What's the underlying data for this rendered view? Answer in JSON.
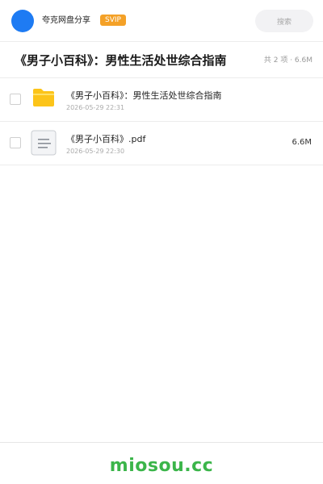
{
  "header": {
    "app_name": "夸克网盘分享",
    "badge": "SVIP",
    "search_placeholder": "搜索"
  },
  "folder": {
    "title": "《男子小百科》：男性生活处世综合指南",
    "summary": "共 2 项 · 6.6M"
  },
  "files": [
    {
      "type": "folder",
      "icon": "folder-icon",
      "name": "《男子小百科》：男性生活处世综合指南",
      "date": "2026-05-29 22:31",
      "size": ""
    },
    {
      "type": "document",
      "icon": "document-icon",
      "name": "《男子小百科》.pdf",
      "date": "2026-05-29 22:30",
      "size": "6.6M"
    }
  ],
  "footer": {
    "brand": "miosou.cc"
  },
  "colors": {
    "avatar": "#1e7bf3",
    "svip_badge": "#f4a127",
    "folder_icon": "#fcc419",
    "brand": "#3bb54a"
  }
}
